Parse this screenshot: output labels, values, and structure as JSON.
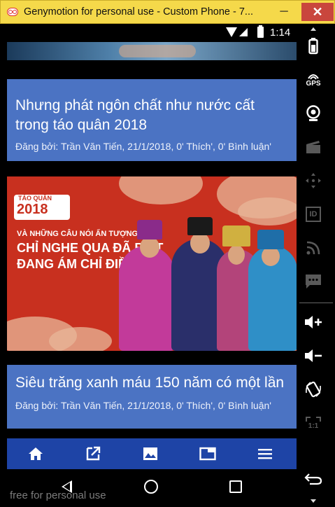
{
  "window": {
    "title": "Genymotion for personal use - Custom Phone - 7...",
    "min_label": "─",
    "close_label": "✕"
  },
  "status_bar": {
    "time": "1:14"
  },
  "articles": [
    {
      "title": "Nhưng phát ngôn chất như nước cất trong táo quân 2018",
      "meta": "Đăng bởi: Trần Văn Tiến, 21/1/2018, 0' Thích', 0' Bình luận'"
    },
    {
      "title": "Siêu trăng xanh máu 150 năm có một lần",
      "meta": "Đăng bởi: Trần Văn Tiến, 21/1/2018, 0' Thích', 0' Bình luận'"
    }
  ],
  "feature_image": {
    "badge_top": "TÁO QUÂN",
    "badge_year": "2018",
    "line1": "VÀ NHỮNG CÂU NÓI ẤN TƯỢNG",
    "line2": "CHỈ NGHE QUA ĐÃ BIẾT",
    "line3": "ĐANG ÁM CHỈ ĐIỀU GÌ"
  },
  "bottom_nav": {
    "items": [
      {
        "icon": "home-icon"
      },
      {
        "icon": "open-external-icon"
      },
      {
        "icon": "image-icon"
      },
      {
        "icon": "tab-icon"
      },
      {
        "icon": "menu-icon"
      }
    ],
    "color": "#1e44a6"
  },
  "side_toolbar": {
    "gps_label": "GPS",
    "id_label": "ID",
    "scale_label": "1:1"
  },
  "watermark": "free for personal use",
  "colors": {
    "titlebar": "#f5d94a",
    "card": "#4b73c3",
    "close_button": "#c9463d"
  }
}
